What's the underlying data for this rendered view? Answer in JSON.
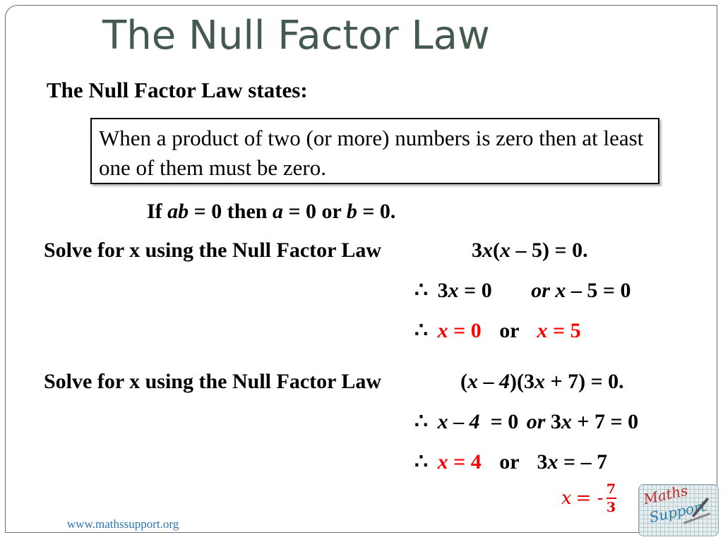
{
  "title": "The Null Factor Law",
  "states_heading": "The Null Factor Law states:",
  "law_box": "When a product of two (or more) numbers is zero then at least one of them must be zero.",
  "rule": {
    "if": "If",
    "ab": "ab",
    "eq0a": "= 0 then",
    "a": "a",
    "eq0b": "= 0 or",
    "b": "b",
    "eq0c": "= 0."
  },
  "example1": {
    "prompt": "Solve for x using the Null Factor Law",
    "equation": {
      "p1": "3",
      "x1": "x",
      "p2": "(",
      "x2": "x",
      "p3": " – 5) = 0."
    },
    "step1": {
      "therefore": "∴",
      "a_num": "3",
      "a_x": "x",
      "a_rest": " = 0",
      "or": "or",
      "b_x": "x",
      "b_rest": " – 5 = 0"
    },
    "step2": {
      "therefore": "∴",
      "sol1_x": "x",
      "sol1_rest": " = 0",
      "or": "or",
      "sol2_x": "x",
      "sol2_rest": " = 5"
    }
  },
  "example2": {
    "prompt": "Solve for x using the Null Factor Law",
    "equation": {
      "p1": "(",
      "x1": "x",
      "p2": " – ",
      "four": "4",
      "p3": ")(3",
      "x2": "x",
      "p4": " + 7) = 0."
    },
    "step1": {
      "therefore": "∴",
      "a_x": "x",
      "a_mid": " – ",
      "a_four": "4",
      "a_rest": "  = 0",
      "or": "or",
      "b_num": "3",
      "b_x": "x",
      "b_rest": " + 7 = 0"
    },
    "step2": {
      "therefore": "∴",
      "sol1_x": "x",
      "sol1_rest": " = 4",
      "or": "or",
      "b_num": "3",
      "b_x": "x",
      "b_rest": " = – 7"
    },
    "step3": {
      "lhs": "x",
      "eq": "= -",
      "numerator": "7",
      "denominator": "3"
    }
  },
  "footer_url": "www.mathssupport.org",
  "logo": {
    "line1": "Maths",
    "line2": "Support"
  },
  "colors": {
    "title": "#455a4f",
    "answer": "#ff0000",
    "url": "#2e74b5"
  }
}
